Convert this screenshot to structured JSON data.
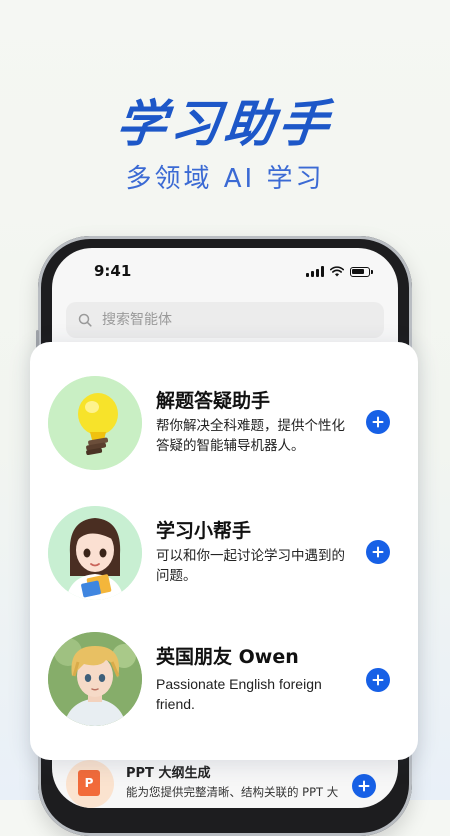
{
  "hero": {
    "title": "学习助手",
    "subtitle": "多领域 AI 学习"
  },
  "status_bar": {
    "time": "9:41"
  },
  "search": {
    "placeholder": "搜索智能体"
  },
  "agents": [
    {
      "name": "解题答疑助手",
      "description": "帮你解决全科难题，提供个性化答疑的智能辅导机器人。",
      "avatar_icon": "lightbulb-icon"
    },
    {
      "name": "学习小帮手",
      "description": "可以和你一起讨论学习中遇到的问题。",
      "avatar_icon": "girl-avatar"
    },
    {
      "name": "英国朋友 Owen",
      "description": "Passionate English foreign friend.",
      "avatar_icon": "boy-avatar"
    }
  ],
  "peek_item": {
    "title": "PPT 大纲生成",
    "description": "能为您提供完整清晰、结构关联的 PPT 大",
    "icon_letter": "P"
  },
  "colors": {
    "accent": "#1760e6",
    "hero": "#1d57c8"
  }
}
